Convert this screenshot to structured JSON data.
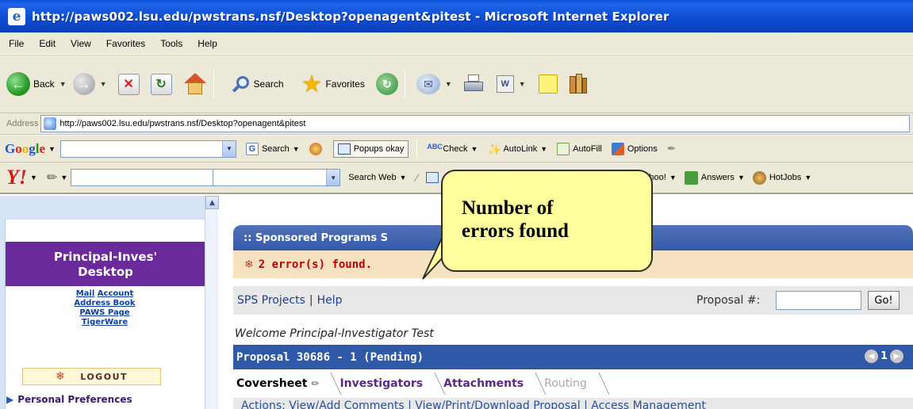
{
  "window": {
    "title": "http://paws002.lsu.edu/pwstrans.nsf/Desktop?openagent&pitest - Microsoft Internet Explorer"
  },
  "menu": [
    "File",
    "Edit",
    "View",
    "Favorites",
    "Tools",
    "Help"
  ],
  "toolbar": {
    "back_label": "Back",
    "search_label": "Search",
    "favorites_label": "Favorites"
  },
  "address": {
    "label": "Address",
    "url": "http://paws002.lsu.edu/pwstrans.nsf/Desktop?openagent&pitest"
  },
  "google_toolbar": {
    "search_label": "Search",
    "popups_label": "Popups okay",
    "check_label": "Check",
    "autolink_label": "AutoLink",
    "autofill_label": "AutoFill",
    "options_label": "Options"
  },
  "yahoo_toolbar": {
    "search_web_label": "Search Web",
    "yahoo_label": "Yahoo!",
    "answers_label": "Answers",
    "hotjobs_label": "HotJobs"
  },
  "left_panel": {
    "title_line1": "Principal-Inves'",
    "title_line2": "Desktop",
    "links": {
      "mail": "Mail",
      "account": "Account",
      "address_book": "Address Book",
      "paws_page": "PAWS Page",
      "tigerware": "TigerWare"
    },
    "logout": "LOGOUT",
    "personal_preferences": "Personal Preferences"
  },
  "main": {
    "header": ":: Sponsored Programs S",
    "error_message": "2 error(s) found.",
    "nav": {
      "sps_projects": "SPS Projects",
      "separator": "|",
      "help": "Help",
      "proposal_label": "Proposal #:",
      "proposal_value": "",
      "go_button": "Go!"
    },
    "welcome": "Welcome Principal-Investigator Test",
    "proposal_title": "Proposal 30686 - 1 (Pending)",
    "pager_number": "1",
    "tabs": [
      "Coversheet",
      "Investigators",
      "Attachments",
      "Routing"
    ],
    "actions_text": "Actions: View/Add Comments | View/Print/Download Proposal | Access Management"
  },
  "callout": {
    "line1": "Number of",
    "line2": "errors found"
  },
  "colors": {
    "title_bar": "#0b4cd3",
    "desktop_title_bg": "#6b2a9c",
    "sps_header_bg": "#4466b0",
    "error_bg": "#f6e2c1",
    "error_text": "#c40000",
    "proposal_bar_bg": "#2e58a8",
    "callout_bg": "#ffff9e"
  }
}
